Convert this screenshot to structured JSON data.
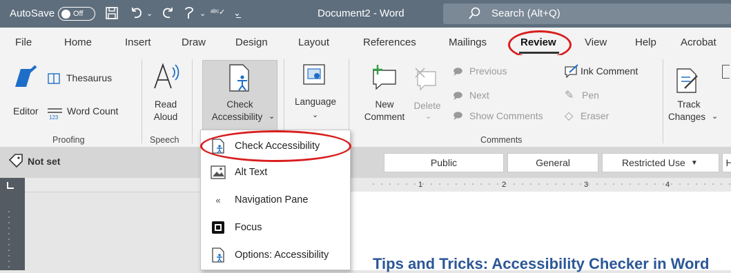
{
  "titlebar": {
    "autosave_label": "AutoSave",
    "autosave_state": "Off",
    "document_title": "Document2 - Word",
    "search_placeholder": "Search (Alt+Q)"
  },
  "tabs": [
    "File",
    "Home",
    "Insert",
    "Draw",
    "Design",
    "Layout",
    "References",
    "Mailings",
    "Review",
    "View",
    "Help",
    "Acrobat"
  ],
  "active_tab": "Review",
  "ribbon": {
    "proofing": {
      "editor": "Editor",
      "thesaurus": "Thesaurus",
      "word_count": "Word Count",
      "group": "Proofing"
    },
    "speech": {
      "read": "Read",
      "aloud": "Aloud",
      "group": "Speech"
    },
    "accessibility": {
      "check": "Check",
      "accessibility": "Accessibility"
    },
    "language": {
      "label": "Language"
    },
    "comments": {
      "new": "New",
      "comment": "Comment",
      "delete": "Delete",
      "previous": "Previous",
      "next": "Next",
      "show_comments": "Show Comments",
      "ink_comment": "Ink Comment",
      "pen": "Pen",
      "eraser": "Eraser",
      "group": "Comments"
    },
    "tracking": {
      "track": "Track",
      "changes": "Changes"
    }
  },
  "sensitivity": {
    "current": "Not set",
    "labels": [
      "Public",
      "General",
      "Restricted Use",
      "H"
    ]
  },
  "ruler_numbers": [
    "1",
    "2",
    "3",
    "4"
  ],
  "menu": {
    "items": [
      {
        "label": "Check Accessibility",
        "icon": "accessibility-check-icon"
      },
      {
        "label": "Alt Text",
        "icon": "alt-text-icon"
      },
      {
        "label": "Navigation Pane",
        "icon": "navigation-pane-icon"
      },
      {
        "label": "Focus",
        "icon": "focus-icon"
      },
      {
        "label": "Options: Accessibility",
        "icon": "accessibility-options-icon"
      }
    ]
  },
  "document": {
    "heading": "Tips and Tricks: Accessibility Checker in Word"
  },
  "colors": {
    "titlebar": "#5f6e7d",
    "highlight": "#d91e1e",
    "heading": "#2b5797"
  }
}
